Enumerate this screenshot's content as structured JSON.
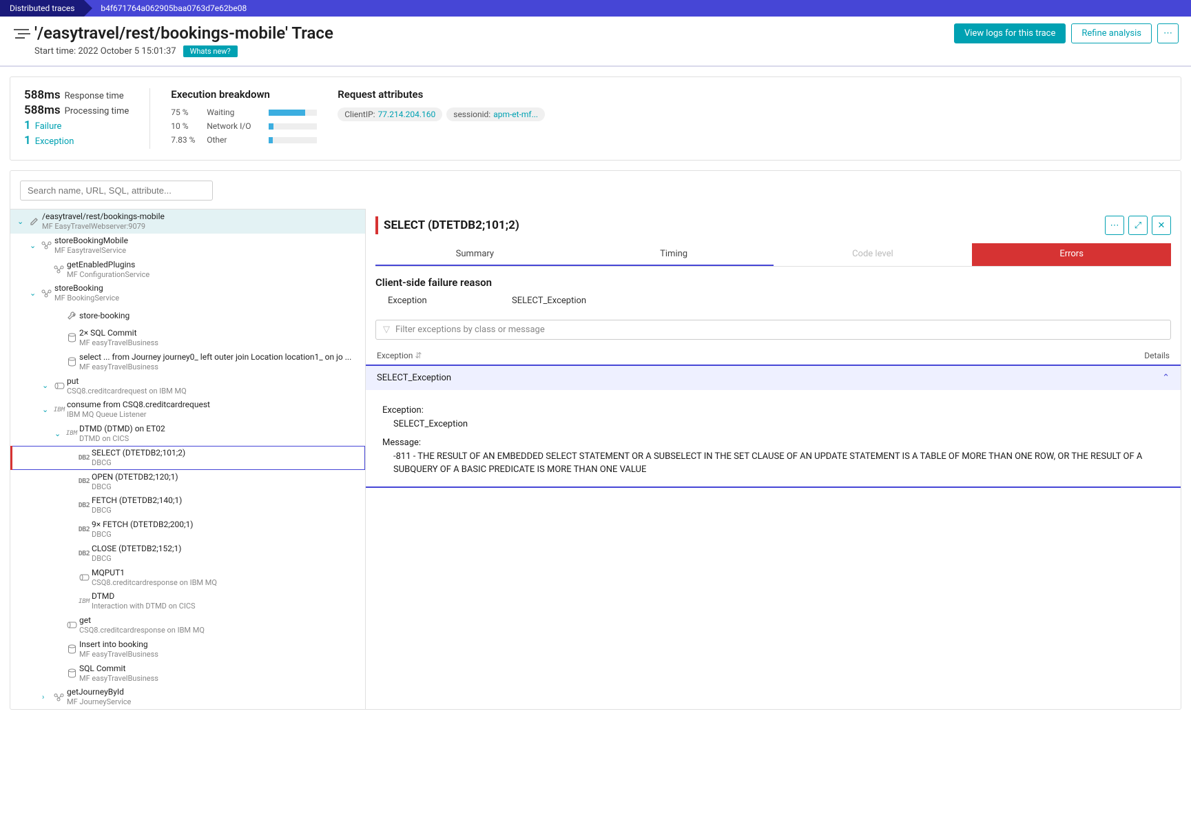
{
  "breadcrumb": {
    "root": "Distributed traces",
    "id": "b4f671764a062905baa0763d7e62be08"
  },
  "header": {
    "title": "'/easytravel/rest/bookings-mobile' Trace",
    "start_time_label": "Start time: 2022 October 5 15:01:37",
    "whats_new": "Whats new?",
    "view_logs": "View logs for this trace",
    "refine": "Refine analysis"
  },
  "summary": {
    "response_time": {
      "value": "588ms",
      "label": "Response time"
    },
    "processing_time": {
      "value": "588ms",
      "label": "Processing time"
    },
    "failure": {
      "count": "1",
      "label": "Failure"
    },
    "exception": {
      "count": "1",
      "label": "Exception"
    },
    "exec_heading": "Execution breakdown",
    "exec": [
      {
        "pct": "75 %",
        "label": "Waiting",
        "fill": 75
      },
      {
        "pct": "10 %",
        "label": "Network I/O",
        "fill": 10
      },
      {
        "pct": "7.83 %",
        "label": "Other",
        "fill": 8
      }
    ],
    "attr_heading": "Request attributes",
    "attrs": [
      {
        "key": "ClientIP:",
        "val": "77.214.204.160"
      },
      {
        "key": "sessionid:",
        "val": "apm-et-mf..."
      }
    ]
  },
  "search_placeholder": "Search name, URL, SQL, attribute...",
  "tree": [
    {
      "depth": 0,
      "toggle": "v",
      "icon": "edit",
      "title": "/easytravel/rest/bookings-mobile",
      "sub": "MF EasyTravelWebserver:9079",
      "root": true
    },
    {
      "depth": 1,
      "toggle": "v",
      "icon": "service",
      "title": "storeBookingMobile",
      "sub": "MF EasytravelService"
    },
    {
      "depth": 2,
      "toggle": "",
      "icon": "service",
      "title": "getEnabledPlugins",
      "sub": "MF ConfigurationService"
    },
    {
      "depth": 1,
      "toggle": "v",
      "icon": "service",
      "title": "storeBooking",
      "sub": "MF BookingService"
    },
    {
      "depth": 3,
      "toggle": "",
      "icon": "wrench",
      "title": "store-booking",
      "sub": ""
    },
    {
      "depth": 3,
      "toggle": "",
      "icon": "db",
      "title": "2× SQL Commit",
      "sub": "MF easyTravelBusiness"
    },
    {
      "depth": 3,
      "toggle": "",
      "icon": "db",
      "title": "select ... from Journey journey0_ left outer join Location location1_ on jo ...",
      "sub": "MF easyTravelBusiness"
    },
    {
      "depth": 2,
      "toggle": "v",
      "icon": "queue",
      "title": "put",
      "sub": "CSQ8.creditcardrequest on IBM MQ"
    },
    {
      "depth": 2,
      "toggle": "v",
      "icon": "ibm",
      "title": "consume from CSQ8.creditcardrequest",
      "sub": "IBM MQ Queue Listener"
    },
    {
      "depth": 3,
      "toggle": "v",
      "icon": "ibm",
      "title": "DTMD (DTMD) on ET02",
      "sub": "DTMD on CICS"
    },
    {
      "depth": 4,
      "toggle": "",
      "icon": "db2",
      "title": "SELECT (DTETDB2;101;2)",
      "sub": "DBCG",
      "error": true
    },
    {
      "depth": 4,
      "toggle": "",
      "icon": "db2",
      "title": "OPEN (DTETDB2;120;1)",
      "sub": "DBCG"
    },
    {
      "depth": 4,
      "toggle": "",
      "icon": "db2",
      "title": "FETCH (DTETDB2;140;1)",
      "sub": "DBCG"
    },
    {
      "depth": 4,
      "toggle": "",
      "icon": "db2",
      "title": "9× FETCH (DTETDB2;200;1)",
      "sub": "DBCG"
    },
    {
      "depth": 4,
      "toggle": "",
      "icon": "db2",
      "title": "CLOSE (DTETDB2;152;1)",
      "sub": "DBCG"
    },
    {
      "depth": 4,
      "toggle": "",
      "icon": "queue",
      "title": "MQPUT1",
      "sub": "CSQ8.creditcardresponse on IBM MQ"
    },
    {
      "depth": 4,
      "toggle": "",
      "icon": "ibm",
      "title": "DTMD",
      "sub": "Interaction with DTMD on CICS"
    },
    {
      "depth": 3,
      "toggle": "",
      "icon": "queue",
      "title": "get",
      "sub": "CSQ8.creditcardresponse on IBM MQ"
    },
    {
      "depth": 3,
      "toggle": "",
      "icon": "db",
      "title": "Insert into booking",
      "sub": "MF easyTravelBusiness"
    },
    {
      "depth": 3,
      "toggle": "",
      "icon": "db",
      "title": "SQL Commit",
      "sub": "MF easyTravelBusiness"
    },
    {
      "depth": 2,
      "toggle": ">",
      "icon": "service",
      "title": "getJourneyById",
      "sub": "MF JourneyService"
    }
  ],
  "detail": {
    "title": "SELECT (DTETDB2;101;2)",
    "tabs": {
      "summary": "Summary",
      "timing": "Timing",
      "code": "Code level",
      "errors": "Errors"
    },
    "failure_heading": "Client-side failure reason",
    "failure_key": "Exception",
    "failure_val": "SELECT_Exception",
    "filter_placeholder": "Filter exceptions by class or message",
    "col_exception": "Exception",
    "col_details": "Details",
    "exc_name": "SELECT_Exception",
    "exc_lbl": "Exception:",
    "exc_val": "SELECT_Exception",
    "msg_lbl": "Message:",
    "msg_val": "-811 - THE RESULT OF AN EMBEDDED SELECT STATEMENT OR A SUBSELECT IN THE SET CLAUSE OF AN UPDATE STATEMENT IS A TABLE OF MORE THAN ONE ROW, OR THE RESULT OF A SUBQUERY OF A BASIC PREDICATE IS MORE THAN ONE VALUE"
  }
}
